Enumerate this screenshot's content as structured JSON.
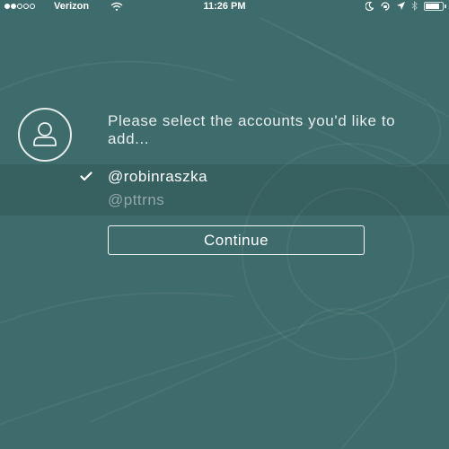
{
  "status_bar": {
    "carrier": "Verizon",
    "time": "11:26 PM",
    "signal_bars_filled": 2,
    "signal_bars_total": 5,
    "battery_level": 0.85
  },
  "header": {
    "prompt": "Please select the accounts you'd like to add..."
  },
  "accounts": [
    {
      "handle": "@robinraszka",
      "selected": true
    },
    {
      "handle": "@pttrns",
      "selected": false
    }
  ],
  "actions": {
    "continue_label": "Continue"
  },
  "colors": {
    "background": "#3e6b6b",
    "selected_band": "#386161",
    "text": "#ffffff"
  },
  "icons": {
    "avatar": "person-icon",
    "check": "checkmark-icon",
    "wifi": "wifi-icon",
    "moon": "moon-icon",
    "rotation_lock": "rotation-lock-icon",
    "location": "location-arrow-icon",
    "bluetooth": "bluetooth-icon",
    "battery": "battery-icon"
  }
}
